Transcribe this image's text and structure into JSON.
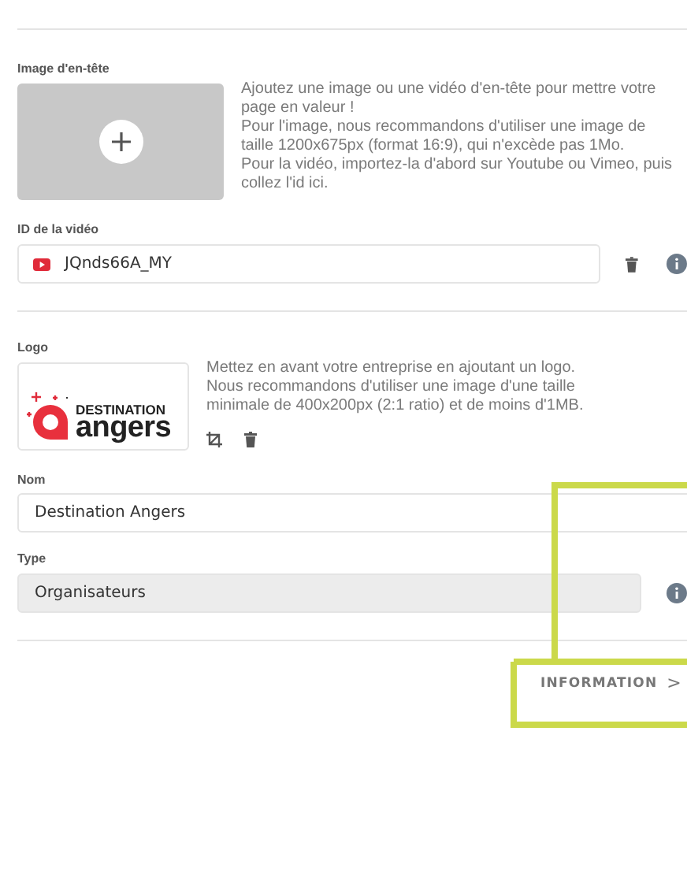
{
  "header_image": {
    "label": "Image d'en-tête",
    "description": "Ajoutez une image ou une vidéo d'en-tête pour mettre votre page en valeur !\nPour l'image, nous recommandons d'utiliser une image de taille 1200x675px (format 16:9), qui n'excède pas 1Mo.\nPour la vidéo, importez-la d'abord sur Youtube ou Vimeo, puis collez l'id ici."
  },
  "video_id": {
    "label": "ID de la vidéo",
    "value": "JQnds66A_MY"
  },
  "logo": {
    "label": "Logo",
    "brand_line_1": "DESTINATION",
    "brand_line_2": "angers",
    "description": "Mettez en avant votre entreprise en ajoutant un logo.\nNous recommandons d'utiliser une image d'une taille minimale de 400x200px (2:1 ratio) et de moins d'1MB."
  },
  "name": {
    "label": "Nom",
    "value": "Destination Angers"
  },
  "type": {
    "label": "Type",
    "value": "Organisateurs",
    "disabled": true
  },
  "next_link": {
    "label": "INFORMATION",
    "icon": ">"
  }
}
